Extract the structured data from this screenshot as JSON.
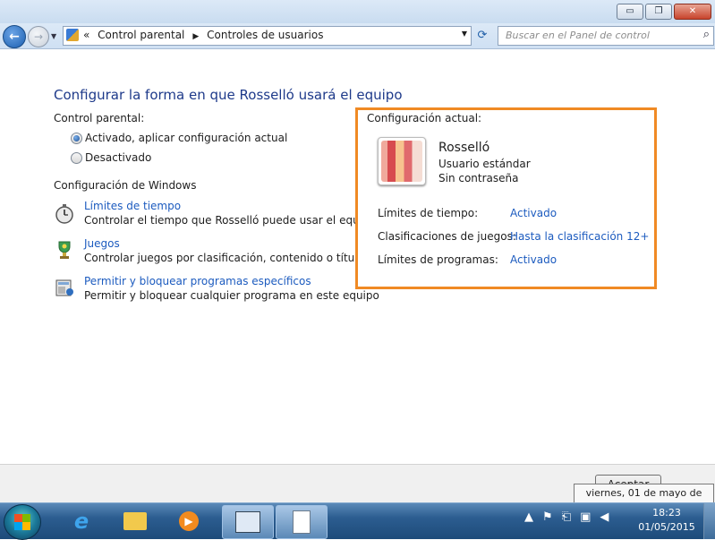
{
  "window": {
    "controls": {
      "minimize": "▭",
      "maximize": "❐",
      "close": "✕"
    }
  },
  "address_bar": {
    "overflow": "«",
    "crumbs": [
      "Control parental",
      "Controles de usuarios"
    ],
    "search_placeholder": "Buscar en el Panel de control"
  },
  "main": {
    "heading": "Configurar la forma en que Rosselló usará el equipo",
    "parental_control_label": "Control parental:",
    "radio_on": "Activado, aplicar configuración actual",
    "radio_off": "Desactivado",
    "selected": "on",
    "windows_settings_label": "Configuración de Windows",
    "tasks": [
      {
        "title": "Límites de tiempo",
        "desc": "Controlar el tiempo que Rosselló puede usar el equipo",
        "icon": "stopwatch-icon"
      },
      {
        "title": "Juegos",
        "desc": "Controlar juegos por clasificación, contenido o título",
        "icon": "games-trophy-icon"
      },
      {
        "title": "Permitir y bloquear programas específicos",
        "desc": "Permitir y bloquear cualquier programa en este equipo",
        "icon": "programs-icon"
      }
    ]
  },
  "current_settings": {
    "label": "Configuración actual:",
    "user_name": "Rosselló",
    "user_type": "Usuario estándar",
    "password": "Sin contraseña",
    "rows": [
      {
        "key": "Límites de tiempo:",
        "value": "Activado"
      },
      {
        "key": "Clasificaciones de juegos:",
        "value": "Hasta la clasificación 12+"
      },
      {
        "key": "Límites de programas:",
        "value": "Activado"
      }
    ],
    "accent_color": "#f08a24"
  },
  "footer": {
    "ok_button": "Aceptar"
  },
  "tooltip": "viernes, 01 de mayo de 2015",
  "taskbar": {
    "items": [
      "internet-explorer",
      "file-explorer",
      "media-player",
      "control-panel",
      "document"
    ],
    "clock_time": "18:23",
    "clock_date": "01/05/2015"
  },
  "colors": {
    "link": "#1c5bbf",
    "heading": "#1e3a8a"
  }
}
